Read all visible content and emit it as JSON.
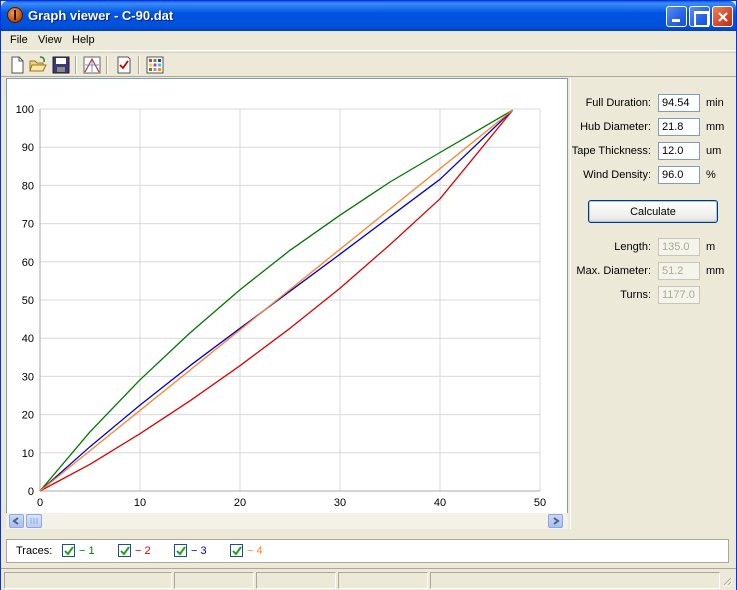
{
  "window": {
    "title": "Graph viewer - C-90.dat"
  },
  "menu": {
    "items": [
      "File",
      "View",
      "Help"
    ]
  },
  "toolbar": {
    "icons": [
      "new-file-icon",
      "open-folder-icon",
      "save-disk-icon",
      "graph-icon",
      "checklist-icon",
      "color-grid-icon"
    ]
  },
  "params": {
    "full_duration": {
      "label": "Full Duration:",
      "value": "94.54",
      "unit": "min"
    },
    "hub_diameter": {
      "label": "Hub Diameter:",
      "value": "21.8",
      "unit": "mm"
    },
    "tape_thickness": {
      "label": "Tape Thickness:",
      "value": "12.0",
      "unit": "um"
    },
    "wind_density": {
      "label": "Wind Density:",
      "value": "96.0",
      "unit": "%"
    }
  },
  "calculate_label": "Calculate",
  "results": {
    "length": {
      "label": "Length:",
      "value": "135.0",
      "unit": "m"
    },
    "max_diameter": {
      "label": "Max. Diameter:",
      "value": "51.2",
      "unit": "mm"
    },
    "turns": {
      "label": "Turns:",
      "value": "1177.0",
      "unit": ""
    }
  },
  "traces": {
    "label": "Traces:",
    "items": [
      {
        "label": "− 1",
        "checked": true,
        "color": "#007700"
      },
      {
        "label": "− 2",
        "checked": true,
        "color": "#DD0000"
      },
      {
        "label": "− 3",
        "checked": true,
        "color": "#0000CC"
      },
      {
        "label": "− 4",
        "checked": true,
        "color": "#FF7F27"
      }
    ]
  },
  "chart_data": {
    "type": "line",
    "xlim": [
      0,
      50
    ],
    "ylim": [
      0,
      100
    ],
    "x_ticks": [
      0,
      10,
      20,
      30,
      40,
      50
    ],
    "y_ticks": [
      0,
      10,
      20,
      30,
      40,
      50,
      60,
      70,
      80,
      90,
      100
    ],
    "grid": true,
    "series": [
      {
        "color": "#007700",
        "x": [
          0,
          5,
          10,
          15,
          20,
          25,
          30,
          35,
          40,
          47.27
        ],
        "y": [
          0,
          15.5,
          29.1,
          41.4,
          52.7,
          63.0,
          72.2,
          80.9,
          88.6,
          99.7
        ]
      },
      {
        "color": "#DD0000",
        "x": [
          0,
          5,
          10,
          15,
          20,
          25,
          30,
          35,
          40,
          47.27
        ],
        "y": [
          0,
          7.0,
          15.0,
          23.6,
          32.8,
          42.6,
          53.1,
          64.5,
          76.5,
          99.7
        ]
      },
      {
        "color": "#0000CC",
        "x": [
          0,
          5,
          10,
          15,
          20,
          25,
          30,
          35,
          40,
          47.27
        ],
        "y": [
          0,
          11.6,
          22.5,
          32.8,
          42.6,
          52.3,
          62.0,
          71.8,
          81.6,
          99.7
        ]
      },
      {
        "color": "#FF7F27",
        "x": [
          0,
          47.27
        ],
        "y": [
          0,
          99.7
        ]
      }
    ]
  }
}
